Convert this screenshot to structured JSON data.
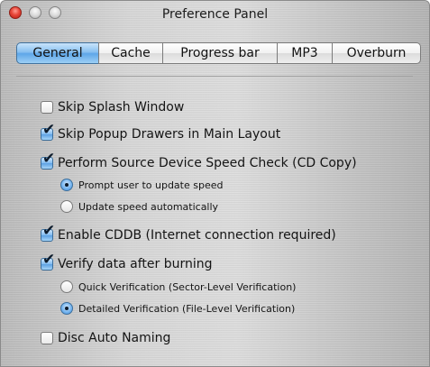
{
  "window": {
    "title": "Preference Panel"
  },
  "tabs": [
    {
      "label": "General",
      "selected": true
    },
    {
      "label": "Cache",
      "selected": false
    },
    {
      "label": "Progress bar",
      "selected": false
    },
    {
      "label": "MP3",
      "selected": false
    },
    {
      "label": "Overburn",
      "selected": false
    }
  ],
  "options": {
    "skip_splash": {
      "label": "Skip Splash Window",
      "checked": false
    },
    "skip_popup_drawers": {
      "label": "Skip Popup Drawers in Main Layout",
      "checked": true
    },
    "speed_check": {
      "label": "Perform Source Device Speed Check (CD Copy)",
      "checked": true
    },
    "speed_prompt": {
      "label": "Prompt user to update speed",
      "selected": true
    },
    "speed_auto": {
      "label": "Update speed automatically",
      "selected": false
    },
    "enable_cddb": {
      "label": "Enable CDDB (Internet connection required)",
      "checked": true
    },
    "verify_data": {
      "label": "Verify data after burning",
      "checked": true
    },
    "verify_quick": {
      "label": "Quick Verification (Sector-Level Verification)",
      "selected": false
    },
    "verify_detailed": {
      "label": "Detailed Verification (File-Level Verification)",
      "selected": true
    },
    "disc_auto_naming": {
      "label": "Disc Auto Naming",
      "checked": false
    }
  },
  "icons": {
    "checkmark": "✔"
  },
  "colors": {
    "accent": "#5ea6e8",
    "close_button": "#e8473a"
  }
}
